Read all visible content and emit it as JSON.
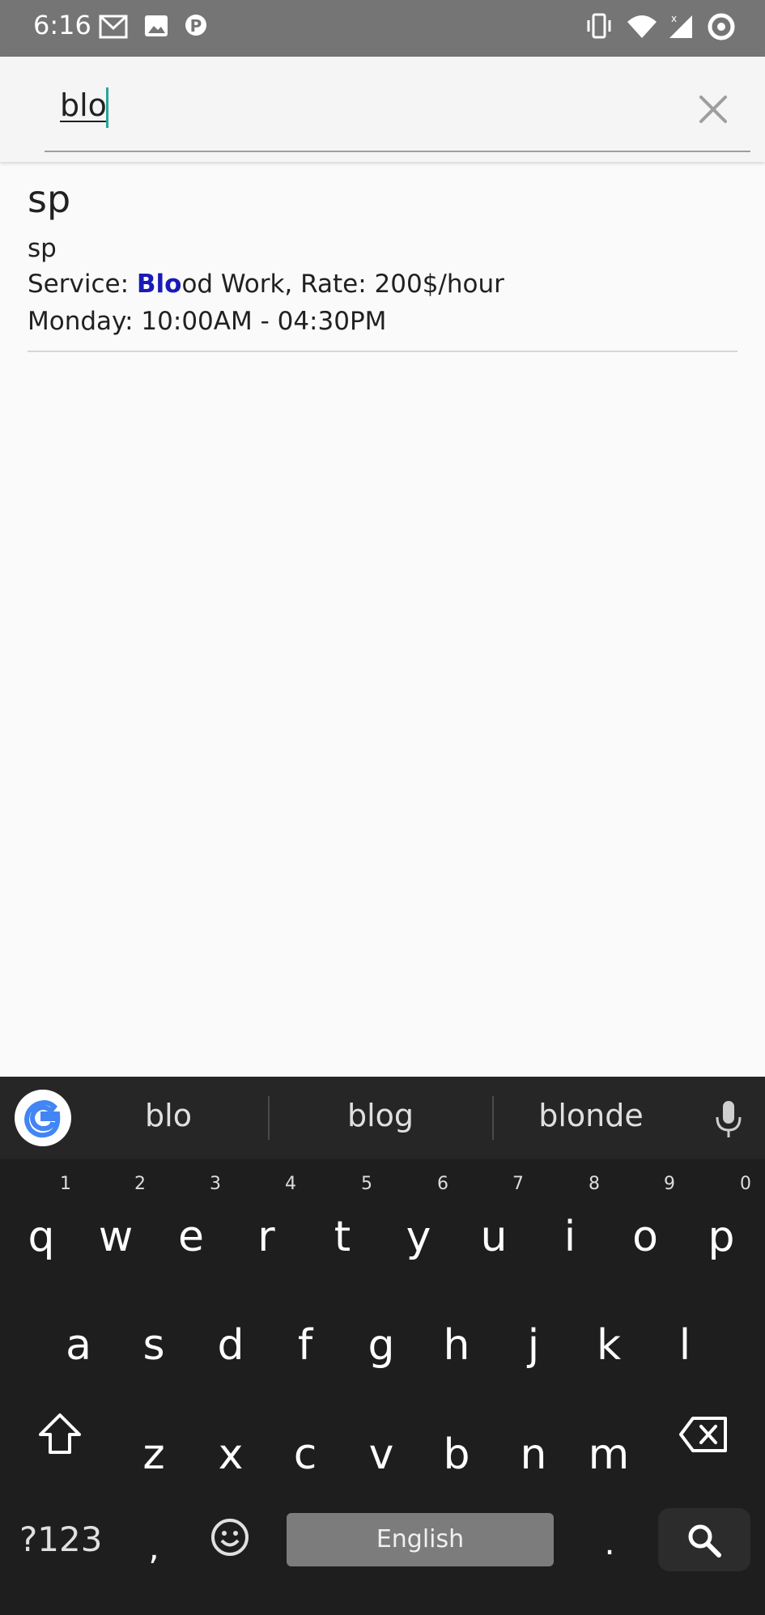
{
  "status_bar": {
    "time": "6:16",
    "icons": [
      "gmail-icon",
      "image-icon",
      "p-icon",
      "vibrate-icon",
      "wifi-icon",
      "signal-icon",
      "sync-icon"
    ]
  },
  "search": {
    "value": "blo"
  },
  "results": [
    {
      "title": "sp",
      "subtitle": "sp",
      "service_prefix": "Service: ",
      "service_highlight": "Blo",
      "service_rest": "od Work, Rate: 200$/hour",
      "schedule": "Monday: 10:00AM - 04:30PM"
    }
  ],
  "keyboard": {
    "suggestions": [
      "blo",
      "blog",
      "blonde"
    ],
    "row1": [
      "q",
      "w",
      "e",
      "r",
      "t",
      "y",
      "u",
      "i",
      "o",
      "p"
    ],
    "row1_nums": [
      "1",
      "2",
      "3",
      "4",
      "5",
      "6",
      "7",
      "8",
      "9",
      "0"
    ],
    "row2": [
      "a",
      "s",
      "d",
      "f",
      "g",
      "h",
      "j",
      "k",
      "l"
    ],
    "row3": [
      "z",
      "x",
      "c",
      "v",
      "b",
      "n",
      "m"
    ],
    "symbols_label": "?123",
    "comma": ",",
    "period": ".",
    "space_label": "English",
    "accent_color": "#26a69a",
    "highlight_color": "#1a1ab8"
  }
}
